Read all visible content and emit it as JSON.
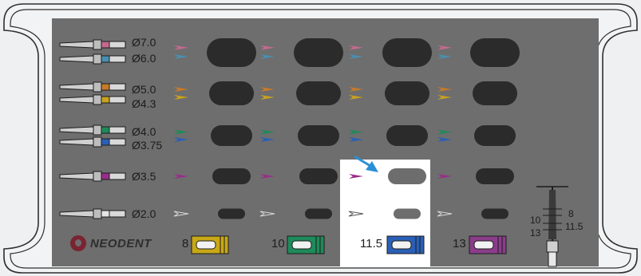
{
  "brand": {
    "name": "NEODENT",
    "trademark": "®"
  },
  "drill_rows": [
    {
      "labels": [
        "Ø7.0",
        "Ø6.0"
      ],
      "colors": [
        "#c56a8f",
        "#4a8fb0"
      ],
      "hole": "xl"
    },
    {
      "labels": [
        "Ø5.0",
        "Ø4.3"
      ],
      "colors": [
        "#c87a2a",
        "#c9a21f"
      ],
      "hole": "lg"
    },
    {
      "labels": [
        "Ø4.0",
        "Ø3.75"
      ],
      "colors": [
        "#1f8a5a",
        "#2a5fb5"
      ],
      "hole": "md"
    },
    {
      "labels": [
        "Ø3.5"
      ],
      "colors": [
        "#9a2d8a"
      ],
      "hole": "sm"
    },
    {
      "labels": [
        "Ø2.0"
      ],
      "colors": [
        "#e6e6e6"
      ],
      "hole": "xs"
    }
  ],
  "columns": [
    {
      "label": "8",
      "stop_color": "#c9a816",
      "highlighted": false
    },
    {
      "label": "10",
      "stop_color": "#1f8a5a",
      "highlighted": false
    },
    {
      "label": "11.5",
      "stop_color": "#2a5fb5",
      "highlighted": true
    },
    {
      "label": "13",
      "stop_color": "#8a3d8a",
      "highlighted": false
    }
  ],
  "depth_gauge": {
    "marks": [
      "8",
      "10",
      "11.5",
      "13"
    ]
  },
  "colors": {
    "tray_bg": "#6e6e6e",
    "tray_outline": "#2f2f2f",
    "hole": "#2b2b2b",
    "highlight": "#ffffff",
    "highlight_hole": "#6d6d6d",
    "arrow": "#2b8fd6"
  }
}
